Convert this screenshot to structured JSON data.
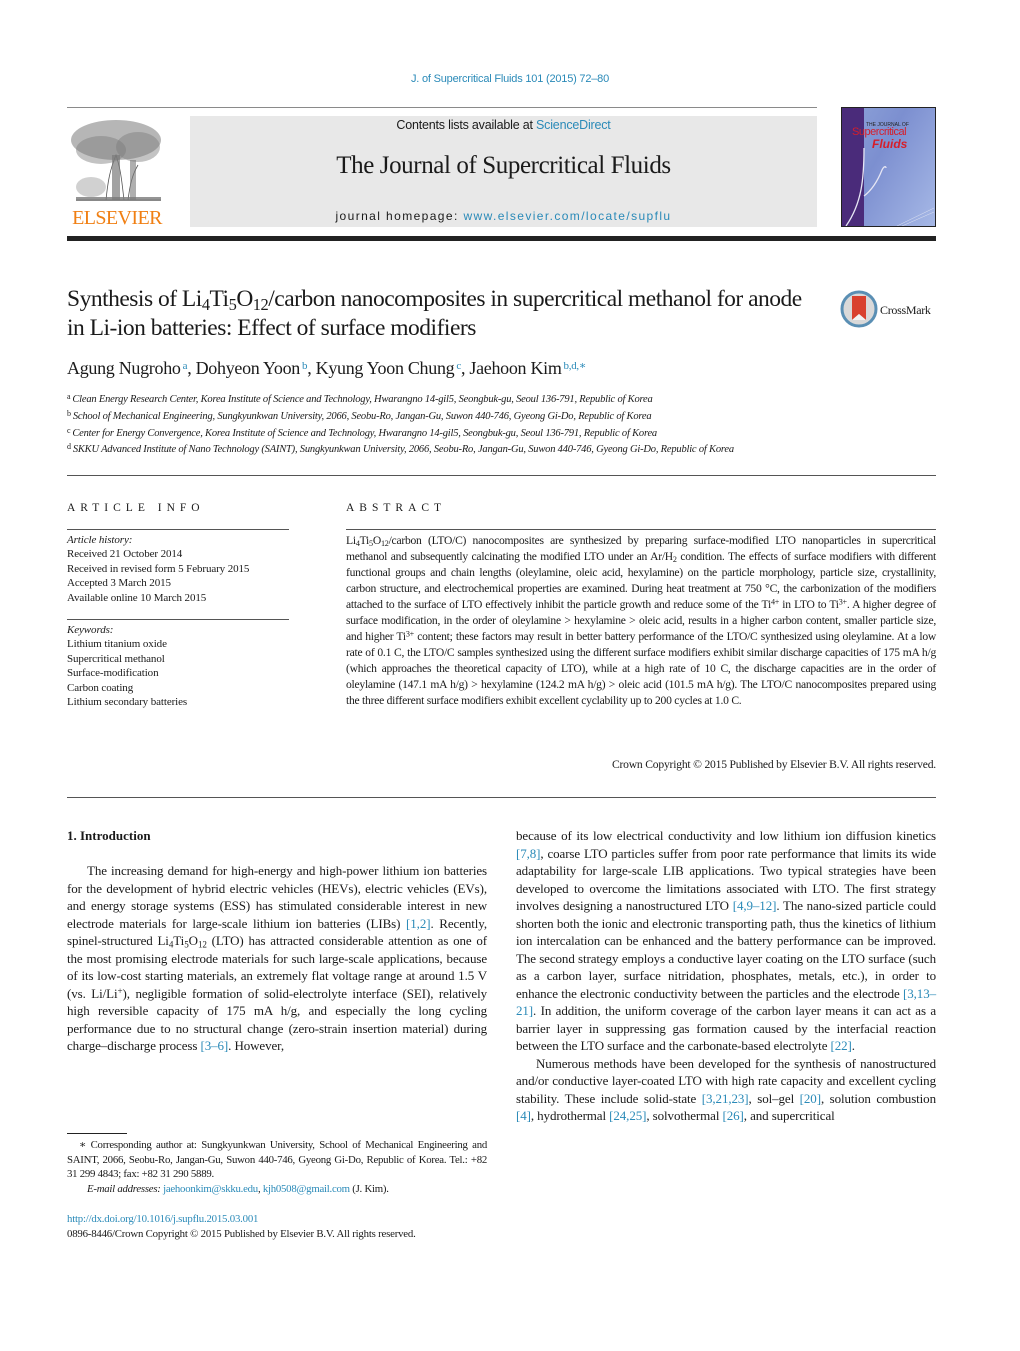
{
  "header": {
    "journal_ref": "J. of Supercritical Fluids 101 (2015) 72–80",
    "contents_prefix": "Contents lists available at ",
    "contents_link": "ScienceDirect",
    "journal_title": "The Journal of Supercritical Fluids",
    "homepage_prefix": "journal homepage: ",
    "homepage_link": "www.elsevier.com/locate/supflu",
    "publisher_logo_text": "ELSEVIER",
    "cover": {
      "small_text": "THE JOURNAL OF",
      "title_line1": "Supercritical",
      "title_line2": "Fluids"
    },
    "colors": {
      "link": "#2a8ab8",
      "elsevier_orange": "#f07f13",
      "cover_red": "#d61e2a"
    }
  },
  "article": {
    "title_part1": "Synthesis of Li",
    "title_sub1": "4",
    "title_part2": "Ti",
    "title_sub2": "5",
    "title_part3": "O",
    "title_sub3": "12",
    "title_part4": "/carbon nanocomposites in supercritical methanol for anode in Li-ion batteries: Effect of surface modifiers",
    "crossmark_label": "CrossMark",
    "authors": [
      {
        "name": "Agung Nugroho",
        "marks": "a"
      },
      {
        "name": "Dohyeon Yoon",
        "marks": "b"
      },
      {
        "name": "Kyung Yoon Chung",
        "marks": "c"
      },
      {
        "name": "Jaehoon Kim",
        "marks": "b,d,∗"
      }
    ],
    "affiliations": [
      {
        "letter": "a",
        "text": "Clean Energy Research Center, Korea Institute of Science and Technology, Hwarangno 14-gil5, Seongbuk-gu, Seoul 136-791, Republic of Korea"
      },
      {
        "letter": "b",
        "text": "School of Mechanical Engineering, Sungkyunkwan University, 2066, Seobu-Ro, Jangan-Gu, Suwon 440-746, Gyeong Gi-Do, Republic of Korea"
      },
      {
        "letter": "c",
        "text": "Center for Energy Convergence, Korea Institute of Science and Technology, Hwarangno 14-gil5, Seongbuk-gu, Seoul 136-791, Republic of Korea"
      },
      {
        "letter": "d",
        "text": "SKKU Advanced Institute of Nano Technology (SAINT), Sungkyunkwan University, 2066, Seobu-Ro, Jangan-Gu, Suwon 440-746, Gyeong Gi-Do, Republic of Korea"
      }
    ]
  },
  "article_info": {
    "heading": "ARTICLE INFO",
    "history_label": "Article history:",
    "history": [
      "Received 21 October 2014",
      "Received in revised form 5 February 2015",
      "Accepted 3 March 2015",
      "Available online 10 March 2015"
    ],
    "keywords_label": "Keywords:",
    "keywords": [
      "Lithium titanium oxide",
      "Supercritical methanol",
      "Surface-modification",
      "Carbon coating",
      "Lithium secondary batteries"
    ]
  },
  "abstract": {
    "heading": "ABSTRACT",
    "p1": "Li",
    "p1_sub1": "4",
    "p1b": "Ti",
    "p1_sub2": "5",
    "p1c": "O",
    "p1_sub3": "12",
    "p2": "/carbon (LTO/C) nanocomposites are synthesized by preparing surface-modified LTO nanoparticles in supercritical methanol and subsequently calcinating the modified LTO under an Ar/H",
    "p2_sub": "2",
    "p3": " condition. The effects of surface modifiers with different functional groups and chain lengths (oleylamine, oleic acid, hexylamine) on the particle morphology, particle size, crystallinity, carbon structure, and electrochemical properties are examined. During heat treatment at 750 °C, the carbonization of the modifiers attached to the surface of LTO effectively inhibit the particle growth and reduce some of the Ti",
    "p3_sup": "4+",
    "p4": " in LTO to Ti",
    "p4_sup": "3+",
    "p5": ". A higher degree of surface modification, in the order of oleylamine > hexylamine > oleic acid, results in a higher carbon content, smaller particle size, and higher Ti",
    "p5_sup": "3+",
    "p6": " content; these factors may result in better battery performance of the LTO/C synthesized using oleylamine. At a low rate of 0.1 C, the LTO/C samples synthesized using the different surface modifiers exhibit similar discharge capacities of 175 mA h/g (which approaches the theoretical capacity of LTO), while at a high rate of 10 C, the discharge capacities are in the order of oleylamine (147.1 mA h/g) > hexylamine (124.2 mA h/g) > oleic acid (101.5 mA h/g). The LTO/C nanocomposites prepared using the three different surface modifiers exhibit excellent cyclability up to 200 cycles at 1.0 C.",
    "copyright": "Crown Copyright © 2015 Published by Elsevier B.V. All rights reserved."
  },
  "introduction": {
    "heading": "1.  Introduction",
    "left": {
      "t1": "The increasing demand for high-energy and high-power lithium ion batteries for the development of hybrid electric vehicles (HEVs), electric vehicles (EVs), and energy storage systems (ESS) has stimulated considerable interest in new electrode materials for large-scale lithium ion batteries (LIBs) ",
      "r1": "[1,2]",
      "t2": ". Recently, spinel-structured Li",
      "s1": "4",
      "t3": "Ti",
      "s2": "5",
      "t4": "O",
      "s3": "12",
      "t5": " (LTO) has attracted considerable attention as one of the most promising electrode materials for such large-scale applications, because of its low-cost starting materials, an extremely flat voltage range at around 1.5 V (vs. Li/Li",
      "sup1": "+",
      "t6": "), negligible formation of solid-electrolyte interface (SEI), relatively high reversible capacity of 175 mA h/g, and especially the long cycling performance due to no structural change (zero-strain insertion material) during charge–discharge process ",
      "r2": "[3–6]",
      "t7": ". However,"
    },
    "right": {
      "t1": "because of its low electrical conductivity and low lithium ion diffusion kinetics ",
      "r1": "[7,8]",
      "t2": ", coarse LTO particles suffer from poor rate performance that limits its wide adaptability for large-scale LIB applications. Two typical strategies have been developed to overcome the limitations associated with LTO. The first strategy involves designing a nanostructured LTO ",
      "r2": "[4,9–12]",
      "t3": ". The nano-sized particle could shorten both the ionic and electronic transporting path, thus the kinetics of lithium ion intercalation can be enhanced and the battery performance can be improved. The second strategy employs a conductive layer coating on the LTO surface (such as a carbon layer, surface nitridation, phosphates, metals, etc.), in order to enhance the electronic conductivity between the particles and the electrode ",
      "r3": "[3,13–21]",
      "t4": ". In addition, the uniform coverage of the carbon layer means it can act as a barrier layer in suppressing gas formation caused by the interfacial reaction between the LTO surface and the carbonate-based electrolyte ",
      "r4": "[22]",
      "t5": ".",
      "p2_t1": "Numerous methods have been developed for the synthesis of nanostructured and/or conductive layer-coated LTO with high rate capacity and excellent cycling stability. These include solid-state ",
      "p2_r1": "[3,21,23]",
      "p2_t2": ", sol–gel ",
      "p2_r2": "[20]",
      "p2_t3": ", solution combustion ",
      "p2_r3": "[4]",
      "p2_t4": ", hydrothermal ",
      "p2_r4": "[24,25]",
      "p2_t5": ", solvothermal ",
      "p2_r5": "[26]",
      "p2_t6": ", and supercritical"
    }
  },
  "footnote": {
    "corresponding": "∗ Corresponding author at: Sungkyunkwan University, School of Mechanical Engineering and SAINT, 2066, Seobu-Ro, Jangan-Gu, Suwon 440-746, Gyeong Gi-Do, Republic of Korea. Tel.: +82 31 299 4843; fax: +82 31 290 5889.",
    "email_label": "E-mail addresses:",
    "email1": "jaehoonkim@skku.edu",
    "email2": "kjh0508@gmail.com",
    "email_suffix": " (J. Kim).",
    "doi": "http://dx.doi.org/10.1016/j.supflu.2015.03.001",
    "issn_copyright": "0896-8446/Crown Copyright © 2015 Published by Elsevier B.V. All rights reserved."
  }
}
